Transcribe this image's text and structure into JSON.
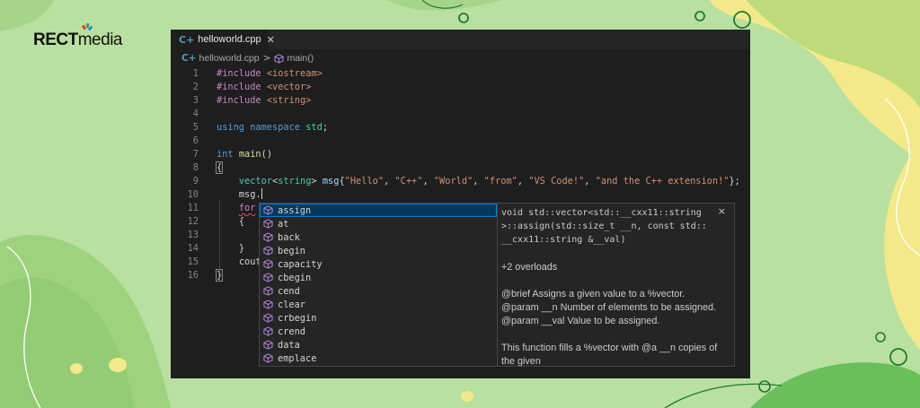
{
  "logo": {
    "brand": "RECT",
    "suffix": "media"
  },
  "colors": {
    "accent_selection": "#04395e",
    "focus_border": "#007fd4",
    "editor_bg": "#1e1e1e",
    "page_bg": "#b9e0a0"
  },
  "tab": {
    "icon": "cpp-file-icon",
    "label": "helloworld.cpp",
    "close": "✕"
  },
  "breadcrumb": {
    "file": "helloworld.cpp",
    "separator": ">",
    "symbol": "main()"
  },
  "code": {
    "line_numbers": [
      "1",
      "2",
      "3",
      "4",
      "5",
      "6",
      "7",
      "8",
      "9",
      "10",
      "11",
      "12",
      "13",
      "14",
      "15",
      "16"
    ],
    "include_kw": "#include",
    "includes": [
      "<iostream>",
      "<vector>",
      "<string>"
    ],
    "using_kw": "using",
    "namespace_kw": "namespace",
    "namespace_name": "std",
    "semicolon": ";",
    "int_kw": "int",
    "main_fn": "main",
    "parens": "()",
    "open_brace": "{",
    "close_brace": "}",
    "vector_type": "vector",
    "string_type": "string",
    "lt": "<",
    "gt": ">",
    "msg_var": "msg",
    "init_open": "{",
    "init_close": "};",
    "strings": [
      "\"Hello\"",
      "\"C++\"",
      "\"World\"",
      "\"from\"",
      "\"VS Code!\"",
      "\"and the C++ extension!\""
    ],
    "comma": ", ",
    "typed": "msg.",
    "for_kw": "for",
    "brace_inner_open": "{",
    "brace_inner_close": "}",
    "cout": "cout"
  },
  "suggestions": {
    "selected_index": 0,
    "items": [
      "assign",
      "at",
      "back",
      "begin",
      "capacity",
      "cbegin",
      "cend",
      "clear",
      "crbegin",
      "crend",
      "data",
      "emplace"
    ]
  },
  "details": {
    "close": "×",
    "signature": [
      "void std::vector<std::__cxx11::string",
      ">::assign(std::size_t __n, const std::",
      "__cxx11::string &__val)"
    ],
    "overloads": "+2 overloads",
    "brief": "@brief Assigns a given value to a %vector.",
    "param1": "@param __n Number of elements to be assigned.",
    "param2": "@param __val Value to be assigned.",
    "desc1": "This function fills a %vector with @a __n copies of",
    "desc2": "the given"
  }
}
